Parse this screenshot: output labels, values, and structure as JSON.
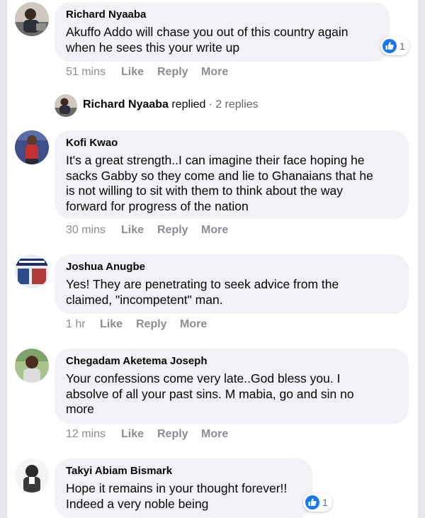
{
  "colors": {
    "bubble": "#f0f2f5",
    "meta_text": "#8a8d91",
    "like_blue": "#1877f2",
    "rail": "#e4e6eb"
  },
  "icons": {
    "like_reaction": "thumbs-up-icon"
  },
  "comments": [
    {
      "author": "Richard Nyaaba",
      "lines": [
        "Akuffo Addo will chase you out of this country again",
        "when he sees this your write up"
      ],
      "time": "51 mins",
      "actions": [
        "Like",
        "Reply",
        "More"
      ],
      "reactions": "1"
    },
    {
      "author": "Kofi Kwao",
      "lines": [
        "It's a great strength..I can imagine their face hoping he",
        "sacks Gabby so they come and lie to Ghanaians that he",
        "is not willing to sit with them to think about the way",
        "forward for progress of the nation"
      ],
      "time": "30 mins",
      "actions": [
        "Like",
        "Reply",
        "More"
      ]
    },
    {
      "author": "Joshua Anugbe",
      "lines": [
        "Yes! They are penetrating to seek advice from the",
        "claimed, \"incompetent\" man."
      ],
      "time": "1 hr",
      "actions": [
        "Like",
        "Reply",
        "More"
      ]
    },
    {
      "author": "Chegadam Aketema Joseph",
      "lines": [
        "Your confessions come very late..God bless you. I",
        "absolve of all your past sins. M mabia, go and sin no",
        "more"
      ],
      "time": "12 mins",
      "actions": [
        "Like",
        "Reply",
        "More"
      ]
    },
    {
      "author": "Takyi Abiam Bismark",
      "lines": [
        "Hope it remains in your thought forever!!",
        "Indeed a very noble being"
      ],
      "reactions": "1"
    }
  ],
  "replies_summary": {
    "name": "Richard Nyaaba",
    "word": "replied",
    "separator": "·",
    "count": "2 replies"
  }
}
